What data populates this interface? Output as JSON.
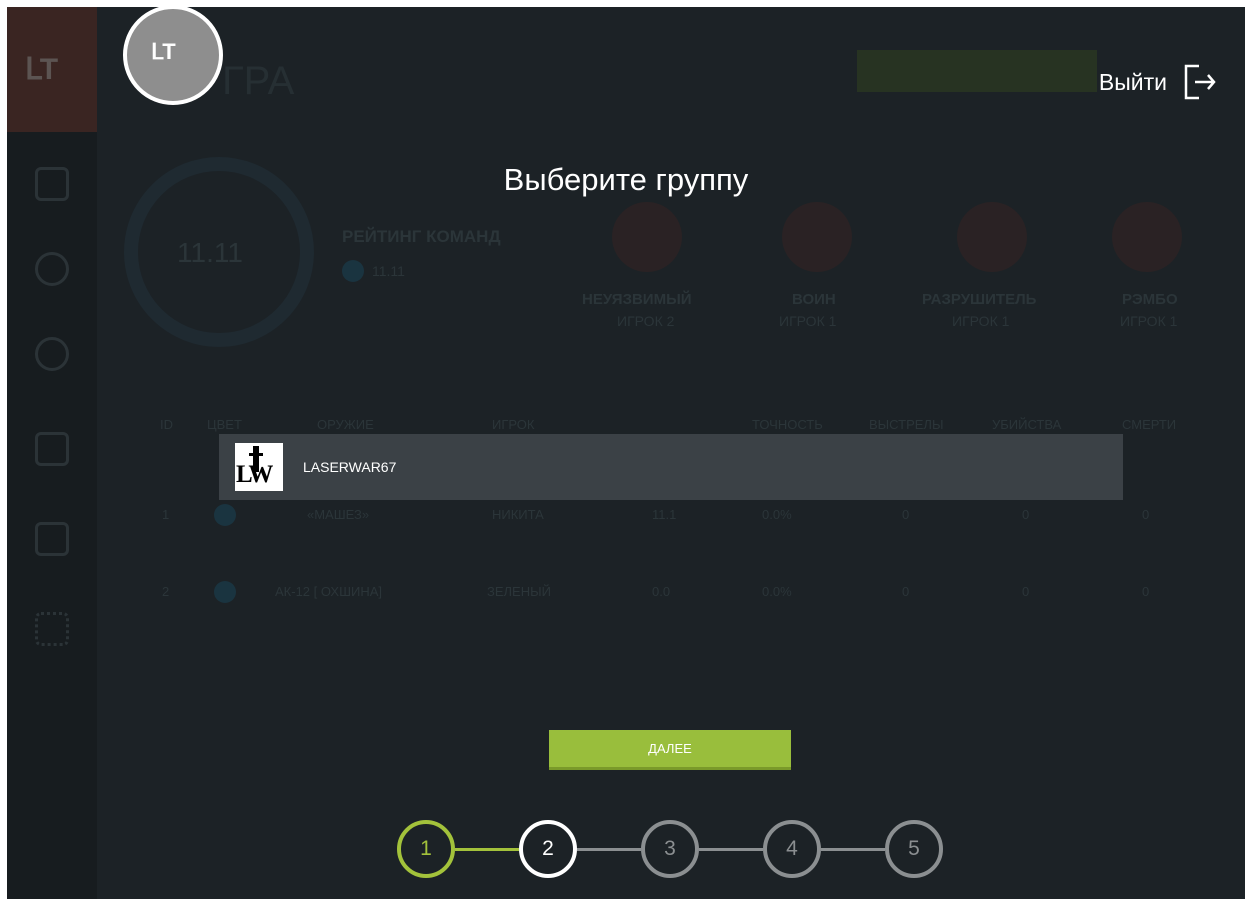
{
  "background": {
    "page_title": "ГРА",
    "timer": "11.11",
    "rating_label": "РЕЙТИНГ КОМАНД",
    "rating_value": "11.11",
    "awards": [
      {
        "title": "НЕУЯЗВИМЫЙ",
        "player": "ИГРОК 2"
      },
      {
        "title": "ВОИН",
        "player": "ИГРОК 1"
      },
      {
        "title": "РАЗРУШИТЕЛЬ",
        "player": "ИГРОК 1"
      },
      {
        "title": "РЭМБО",
        "player": "ИГРОК 1"
      }
    ],
    "table_headers": [
      "ID",
      "ЦВЕТ",
      "ОРУЖИЕ",
      "ИГРОК",
      "ТОЧНОСТЬ",
      "ВЫСТРЕЛЫ",
      "УБИЙСТВА",
      "СМЕРТИ"
    ],
    "rows": [
      {
        "id": "1",
        "weapon": "«МАШЕЗ»",
        "player": "НИКИТА",
        "score": "11.1",
        "accuracy": "0.0%",
        "shots": "0",
        "kills": "0",
        "deaths": "0"
      },
      {
        "id": "2",
        "weapon": "АК-12 [ ОХШИНА]",
        "player": "ЗЕЛЕНЫЙ",
        "score": "0.0",
        "accuracy": "0.0%",
        "shots": "0",
        "kills": "0",
        "deaths": "0"
      }
    ]
  },
  "header": {
    "avatar_text": "ᒪT",
    "logout_label": "Выйти"
  },
  "dialog": {
    "heading": "Выберите группу",
    "groups": [
      {
        "logo_text": "LW",
        "name": "LASERWAR67"
      }
    ],
    "next_button": "ДАЛЕЕ"
  },
  "stepper": {
    "steps": [
      "1",
      "2",
      "3",
      "4",
      "5"
    ],
    "current_step": 2
  },
  "colors": {
    "accent": "#a3c23b",
    "button": "#99be3c",
    "background": "#1c2226",
    "list_item": "#3b4146"
  }
}
